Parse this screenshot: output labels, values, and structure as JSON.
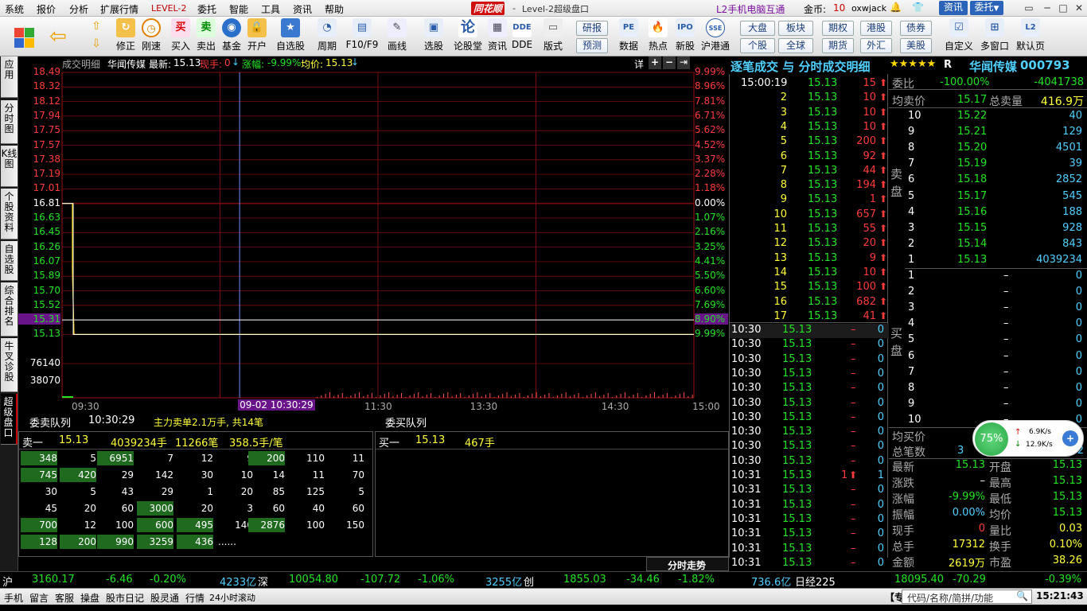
{
  "menu": {
    "items": [
      "系统",
      "报价",
      "分析",
      "扩展行情",
      "LEVEL-2",
      "委托",
      "智能",
      "工具",
      "资讯",
      "帮助"
    ],
    "app_title": "Level-2超级盘口",
    "logo_text": "同花顺",
    "mobile_link": "L2手机电脑互通",
    "gold_label": "金币:",
    "gold_value": "10",
    "username": "oxwjack",
    "news_button": "资讯",
    "trade_button": "委托"
  },
  "toolbar": {
    "buttons": [
      "修正",
      "刚速",
      "买入",
      "卖出",
      "基金",
      "开户",
      "自选股",
      "周期",
      "F10/F9",
      "画线",
      "选股",
      "论股堂",
      "资讯",
      "DDE",
      "版式",
      "数据",
      "热点",
      "新股",
      "沪港通",
      "自定义",
      "多窗口",
      "默认页"
    ],
    "small": [
      "研报",
      "预测",
      "大盘",
      "板块",
      "期权",
      "港股",
      "债券",
      "个股",
      "全球",
      "期货",
      "外汇",
      "美股"
    ]
  },
  "sidetabs": [
    "应用",
    "分时图",
    "K线图",
    "个股资料",
    "自选股",
    "综合排名",
    "牛叉诊股",
    "超级盘口"
  ],
  "chart": {
    "header_tab": "成交明细",
    "stock_name": "华闻传媒",
    "latest_label": "最新:",
    "latest_value": "15.13",
    "now_hand_label": "现手:",
    "now_hand_value": "0",
    "change_label": "涨幅:",
    "change_value": "-9.99%",
    "avg_label": "均价:",
    "avg_value": "15.13",
    "detail_btn": "详",
    "price_ticks": [
      "18.49",
      "18.32",
      "18.12",
      "17.94",
      "17.75",
      "17.57",
      "17.38",
      "17.19",
      "17.01",
      "16.81",
      "16.63",
      "16.45",
      "16.26",
      "16.07",
      "15.89",
      "15.70",
      "15.52",
      "15.31",
      "15.13"
    ],
    "pct_ticks": [
      "9.99%",
      "8.96%",
      "7.81%",
      "6.71%",
      "5.62%",
      "4.52%",
      "3.37%",
      "2.28%",
      "1.18%",
      "0.00%",
      "1.07%",
      "2.16%",
      "3.25%",
      "4.41%",
      "5.50%",
      "6.60%",
      "7.69%",
      "8.90%",
      "9.99%"
    ],
    "vol_ticks": [
      "76140",
      "38070"
    ],
    "time_ticks": [
      "09:30",
      "11:30",
      "13:30",
      "14:30",
      "15:00"
    ],
    "cursor_time": "09-02 10:30:29"
  },
  "queue": {
    "sell_title": "委卖队列",
    "sell_time": "10:30:29",
    "main_info": "主力卖单2.1万手, 共14笔",
    "buy_title": "委买队列",
    "sell1_label": "卖一",
    "sell1_price": "15.13",
    "sell1_vol": "4039234手",
    "sell1_count": "11266笔",
    "sell1_avg": "358.5手/笔",
    "buy1_label": "买一",
    "buy1_price": "15.13",
    "buy1_vol": "467手",
    "rows": [
      [
        "348",
        "5",
        "6951",
        "7",
        "12",
        "9",
        "200",
        "110",
        "11"
      ],
      [
        "745",
        "420",
        "29",
        "142",
        "30",
        "10",
        "14",
        "11",
        "70"
      ],
      [
        "30",
        "5",
        "43",
        "29",
        "1",
        "20",
        "85",
        "125",
        "5"
      ],
      [
        "45",
        "20",
        "60",
        "3000",
        "20",
        "3",
        "60",
        "40",
        "60"
      ],
      [
        "700",
        "12",
        "100",
        "600",
        "495",
        "140",
        "2876",
        "100",
        "150"
      ],
      [
        "128",
        "200",
        "990",
        "3259",
        "436",
        "......",
        "",
        "",
        ""
      ]
    ],
    "highlight": [
      [
        1,
        0,
        1,
        0,
        0,
        0,
        1,
        0,
        0
      ],
      [
        1,
        1,
        0,
        0,
        0,
        0,
        0,
        0,
        0
      ],
      [
        0,
        0,
        0,
        0,
        0,
        0,
        0,
        0,
        0
      ],
      [
        0,
        0,
        0,
        1,
        0,
        0,
        0,
        0,
        0
      ],
      [
        1,
        0,
        0,
        1,
        1,
        0,
        1,
        0,
        0
      ],
      [
        1,
        1,
        1,
        1,
        1,
        0,
        0,
        0,
        0
      ]
    ]
  },
  "trades": {
    "title": "逐笔成交 与 分时成交明细",
    "stars": "★★★★★",
    "rating_letter": "R",
    "stock_name": "华闻传媒",
    "stock_code": "000793",
    "top_time": "15:00:19",
    "top_rows": [
      [
        "",
        "15.13",
        "15"
      ],
      [
        "2",
        "15.13",
        "10"
      ],
      [
        "3",
        "15.13",
        "10"
      ],
      [
        "4",
        "15.13",
        "10"
      ],
      [
        "5",
        "15.13",
        "200"
      ],
      [
        "6",
        "15.13",
        "92"
      ],
      [
        "7",
        "15.13",
        "44"
      ],
      [
        "8",
        "15.13",
        "194"
      ],
      [
        "9",
        "15.13",
        "1"
      ],
      [
        "10",
        "15.13",
        "657"
      ],
      [
        "11",
        "15.13",
        "55"
      ],
      [
        "12",
        "15.13",
        "20"
      ],
      [
        "13",
        "15.13",
        "9"
      ],
      [
        "14",
        "15.13",
        "10"
      ],
      [
        "15",
        "15.13",
        "100"
      ],
      [
        "16",
        "15.13",
        "682"
      ],
      [
        "17",
        "15.13",
        "41"
      ]
    ],
    "bottom_rows": [
      [
        "10:30",
        "15.13",
        "–",
        "0"
      ],
      [
        "10:30",
        "15.13",
        "–",
        "0"
      ],
      [
        "10:30",
        "15.13",
        "–",
        "0"
      ],
      [
        "10:30",
        "15.13",
        "–",
        "0"
      ],
      [
        "10:30",
        "15.13",
        "–",
        "0"
      ],
      [
        "10:30",
        "15.13",
        "–",
        "0"
      ],
      [
        "10:30",
        "15.13",
        "–",
        "0"
      ],
      [
        "10:30",
        "15.13",
        "–",
        "0"
      ],
      [
        "10:30",
        "15.13",
        "–",
        "0"
      ],
      [
        "10:30",
        "15.13",
        "–",
        "0"
      ],
      [
        "10:31",
        "15.13",
        "1",
        "1"
      ],
      [
        "10:31",
        "15.13",
        "–",
        "0"
      ],
      [
        "10:31",
        "15.13",
        "–",
        "0"
      ],
      [
        "10:31",
        "15.13",
        "–",
        "0"
      ],
      [
        "10:31",
        "15.13",
        "–",
        "0"
      ],
      [
        "10:31",
        "15.13",
        "–",
        "0"
      ],
      [
        "10:31",
        "15.13",
        "–",
        "0"
      ]
    ],
    "footer_btn": "分时走势"
  },
  "book": {
    "ratio_label": "委比",
    "ratio_value": "-100.00%",
    "ratio_diff": "-4041738",
    "avg_sell_label": "均卖价",
    "avg_sell_value": "15.17",
    "total_sell_label": "总卖量",
    "total_sell_value": "416.9万",
    "sell_side_label": "卖盘",
    "buy_side_label": "买盘",
    "sells": [
      [
        "10",
        "15.22",
        "40"
      ],
      [
        "9",
        "15.21",
        "129"
      ],
      [
        "8",
        "15.20",
        "4501"
      ],
      [
        "7",
        "15.19",
        "39"
      ],
      [
        "6",
        "15.18",
        "2852"
      ],
      [
        "5",
        "15.17",
        "545"
      ],
      [
        "4",
        "15.16",
        "188"
      ],
      [
        "3",
        "15.15",
        "928"
      ],
      [
        "2",
        "15.14",
        "843"
      ],
      [
        "1",
        "15.13",
        "4039234"
      ]
    ],
    "buys": [
      [
        "1",
        "–",
        "0"
      ],
      [
        "2",
        "–",
        "0"
      ],
      [
        "3",
        "–",
        "0"
      ],
      [
        "4",
        "–",
        "0"
      ],
      [
        "5",
        "–",
        "0"
      ],
      [
        "6",
        "–",
        "0"
      ],
      [
        "7",
        "–",
        "0"
      ],
      [
        "8",
        "–",
        "0"
      ],
      [
        "9",
        "–",
        "0"
      ],
      [
        "10",
        "–",
        "0"
      ]
    ],
    "avg_buy_label": "均买价",
    "avg_buy_value": "0",
    "total_count_label": "总笔数",
    "total_count_value": "3",
    "total_count_tail": "92",
    "speed_pct": "75%",
    "speed_up": "6.9K/s",
    "speed_down": "12.9K/s",
    "stats": [
      [
        "最新",
        "15.13",
        "开盘",
        "15.13"
      ],
      [
        "涨跌",
        "–",
        "最高",
        "15.13"
      ],
      [
        "涨幅",
        "-9.99%",
        "最低",
        "15.13"
      ],
      [
        "振幅",
        "0.00%",
        "均价",
        "15.13"
      ],
      [
        "现手",
        "0",
        "量比",
        "0.03"
      ],
      [
        "总手",
        "17312",
        "换手",
        "0.10%"
      ],
      [
        "金额",
        "2619万",
        "市盈",
        "38.26"
      ]
    ]
  },
  "index_bar": {
    "sh_label": "沪",
    "sh_value": "3160.17",
    "sh_change": "-6.46",
    "sh_pct": "-0.20%",
    "sh_amount": "4233亿",
    "sz_label": "深",
    "sz_value": "10054.80",
    "sz_change": "-107.72",
    "sz_pct": "-1.06%",
    "sz_amount": "3255亿",
    "cy_label": "创",
    "cy_value": "1855.03",
    "cy_change": "-34.46",
    "cy_pct": "-1.82%",
    "cy_amount": "736.6亿",
    "nk_label": "日经225",
    "nk_value": "18095.40",
    "nk_change": "-70.29",
    "nk_pct": "-0.39%"
  },
  "bottom": {
    "tabs": [
      "手机",
      "留言",
      "客服",
      "操盘",
      "股市日记",
      "股灵通",
      "行情",
      "24小时滚动"
    ],
    "search_placeholder": "代码/名称/简拼/功能",
    "clock": "15:21:43",
    "mark": "【专"
  }
}
